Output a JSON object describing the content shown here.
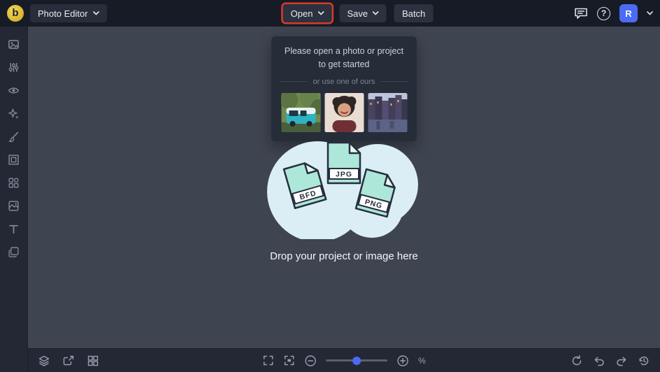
{
  "topbar": {
    "logo_letter": "b",
    "app_menu_label": "Photo Editor",
    "open_label": "Open",
    "save_label": "Save",
    "batch_label": "Batch",
    "help_glyph": "?",
    "avatar_initial": "R"
  },
  "popup": {
    "message": "Please open a photo or project to get started",
    "divider_label": "or use one of ours"
  },
  "dropzone": {
    "file_labels": [
      "BFD",
      "JPG",
      "PNG"
    ],
    "label": "Drop your project or image here"
  },
  "bottombar": {
    "zoom_unit": "%"
  },
  "colors": {
    "topbar_bg": "#171b25",
    "panel_bg": "#232834",
    "canvas_bg": "#3e4450",
    "accent_blue": "#4c6bf5",
    "highlight_red": "#d93a2b",
    "blob_fill": "#dbeef5",
    "file_fill": "#ade7da"
  }
}
